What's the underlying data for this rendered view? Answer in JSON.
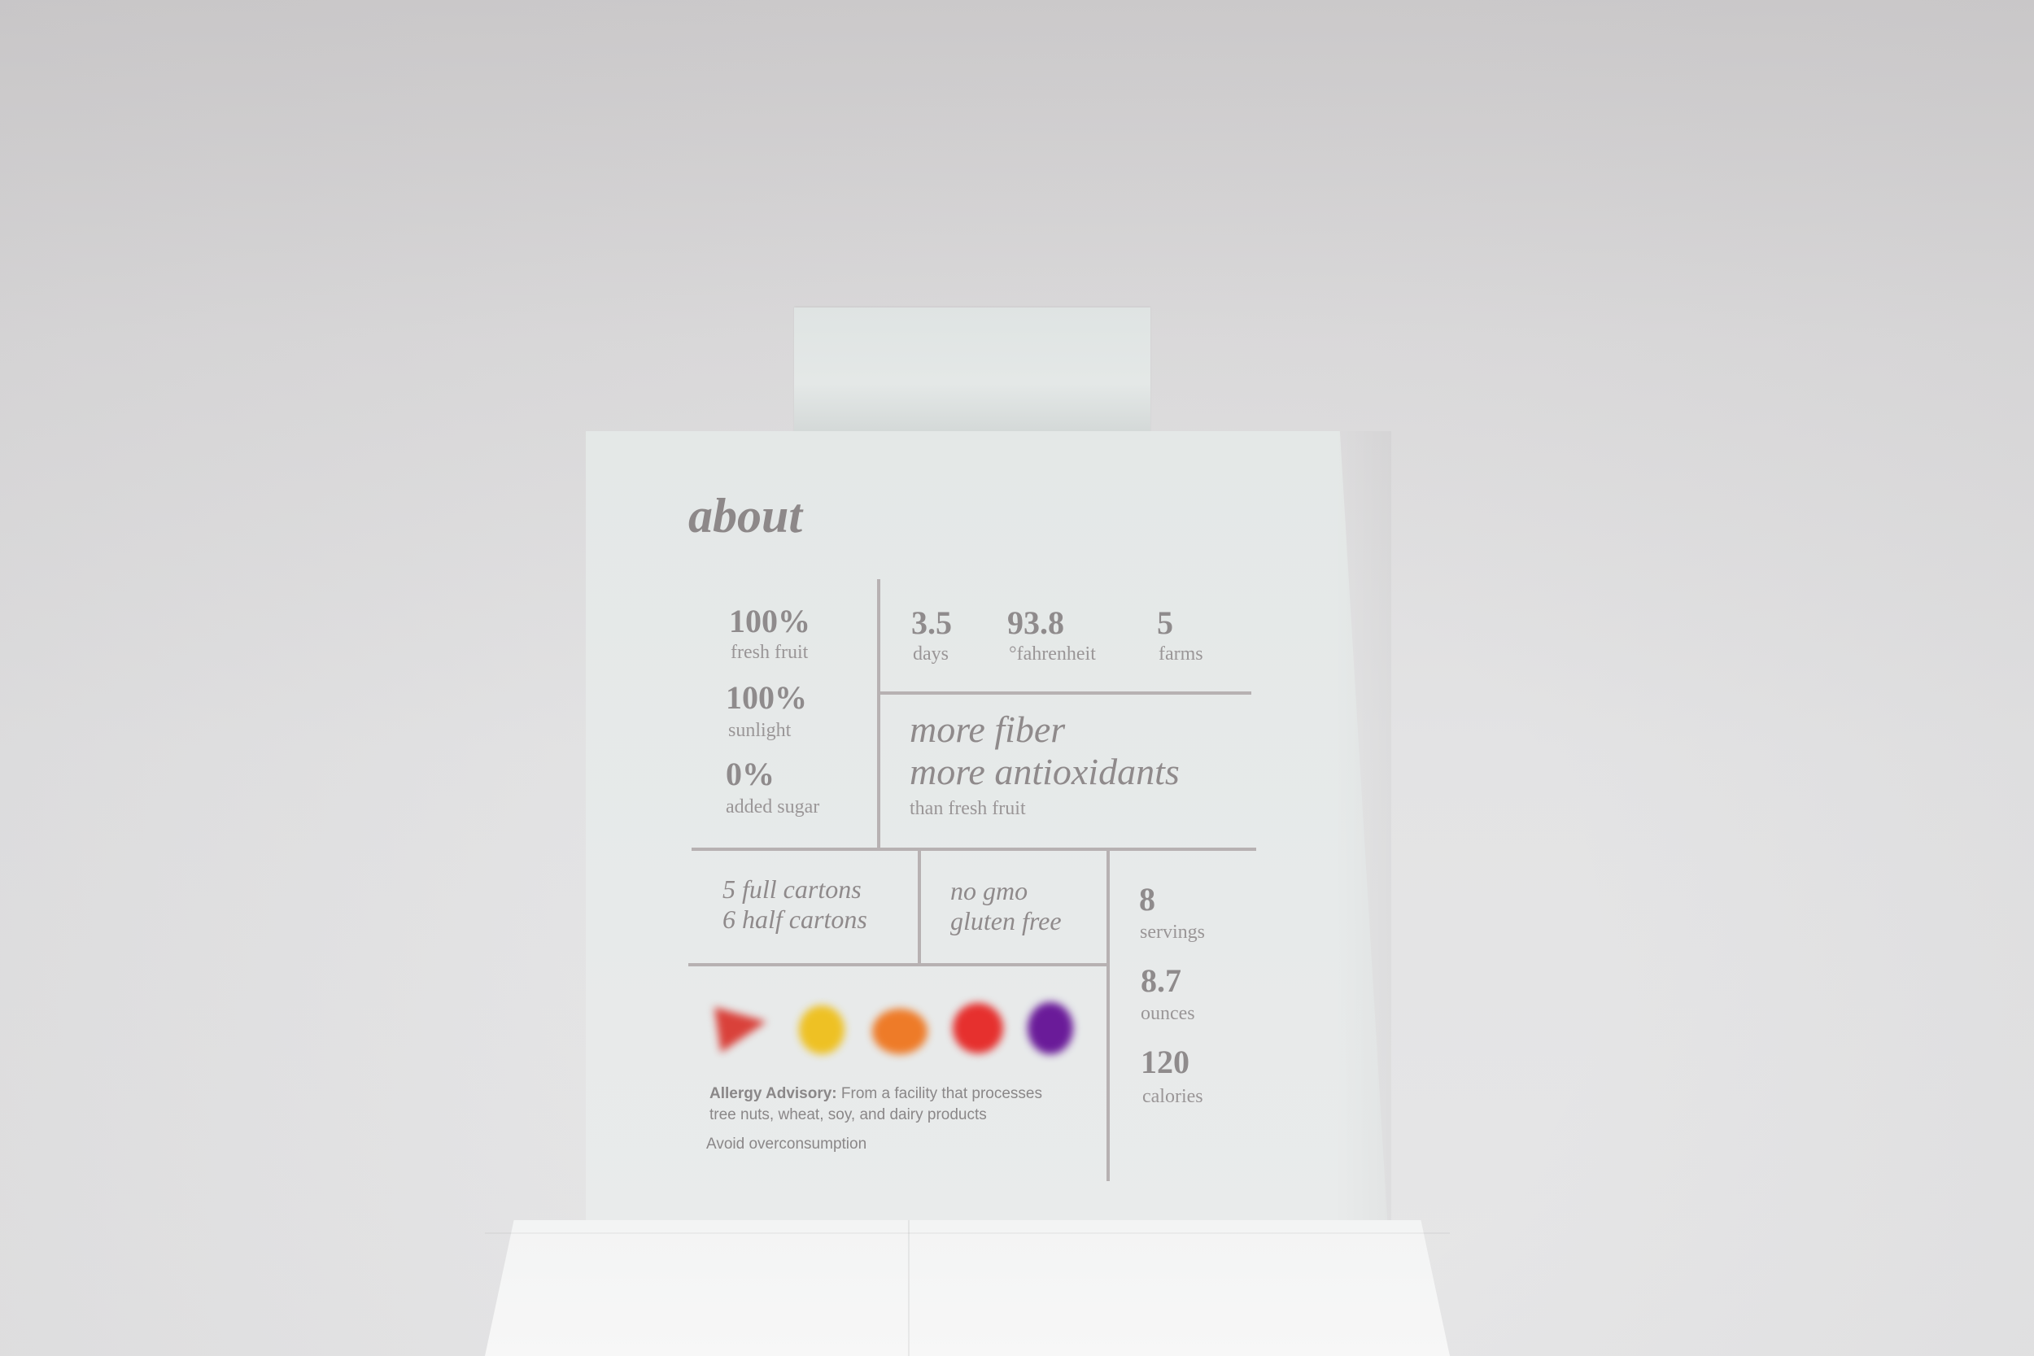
{
  "card": {
    "title": "about",
    "stats_left": [
      {
        "value": "100%",
        "label": "fresh fruit"
      },
      {
        "value": "100%",
        "label": "sunlight"
      },
      {
        "value": "0%",
        "label": "added sugar"
      }
    ],
    "stats_top": [
      {
        "value": "3.5",
        "label": "days"
      },
      {
        "value": "93.8",
        "label": "°fahrenheit"
      },
      {
        "value": "5",
        "label": "farms"
      }
    ],
    "fiber": {
      "line1": "more fiber",
      "line2": "more antioxidants",
      "note": "than fresh fruit"
    },
    "cartons": {
      "line1": "5 full cartons",
      "line2": "6 half cartons"
    },
    "claims": {
      "line1": "no gmo",
      "line2": "gluten free"
    },
    "nutrition": [
      {
        "value": "8",
        "label": "servings"
      },
      {
        "value": "8.7",
        "label": "ounces"
      },
      {
        "value": "120",
        "label": "calories"
      }
    ],
    "fruit_colors": [
      "#d9413a",
      "#eec124",
      "#ee7b28",
      "#e6302e",
      "#6a1b99"
    ],
    "allergy": {
      "heading": "Allergy Advisory:",
      "text1": "From a facility that processes",
      "text2": "tree nuts, wheat, soy, and dairy products",
      "warning": "Avoid overconsumption"
    }
  }
}
